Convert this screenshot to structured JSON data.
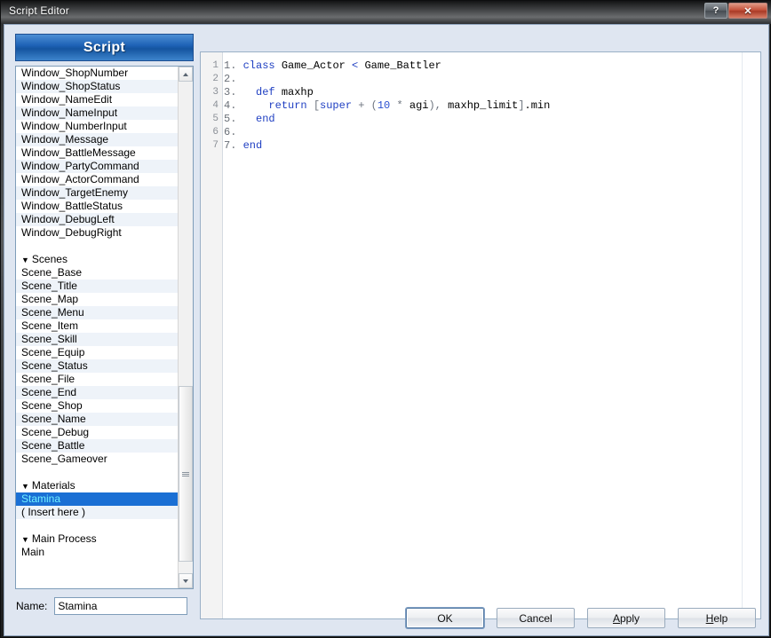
{
  "window": {
    "title": "Script Editor",
    "help_button": "?",
    "close_button": "✕"
  },
  "left_panel": {
    "header": "Script",
    "caret_glyph": "▼",
    "items": [
      {
        "label": "Window_ShopNumber",
        "type": "item"
      },
      {
        "label": "Window_ShopStatus",
        "type": "item"
      },
      {
        "label": "Window_NameEdit",
        "type": "item"
      },
      {
        "label": "Window_NameInput",
        "type": "item"
      },
      {
        "label": "Window_NumberInput",
        "type": "item"
      },
      {
        "label": "Window_Message",
        "type": "item"
      },
      {
        "label": "Window_BattleMessage",
        "type": "item"
      },
      {
        "label": "Window_PartyCommand",
        "type": "item"
      },
      {
        "label": "Window_ActorCommand",
        "type": "item"
      },
      {
        "label": "Window_TargetEnemy",
        "type": "item"
      },
      {
        "label": "Window_BattleStatus",
        "type": "item"
      },
      {
        "label": "Window_DebugLeft",
        "type": "item"
      },
      {
        "label": "Window_DebugRight",
        "type": "item"
      },
      {
        "label": "",
        "type": "blank"
      },
      {
        "label": "Scenes",
        "type": "group"
      },
      {
        "label": "Scene_Base",
        "type": "item"
      },
      {
        "label": "Scene_Title",
        "type": "item"
      },
      {
        "label": "Scene_Map",
        "type": "item"
      },
      {
        "label": "Scene_Menu",
        "type": "item"
      },
      {
        "label": "Scene_Item",
        "type": "item"
      },
      {
        "label": "Scene_Skill",
        "type": "item"
      },
      {
        "label": "Scene_Equip",
        "type": "item"
      },
      {
        "label": "Scene_Status",
        "type": "item"
      },
      {
        "label": "Scene_File",
        "type": "item"
      },
      {
        "label": "Scene_End",
        "type": "item"
      },
      {
        "label": "Scene_Shop",
        "type": "item"
      },
      {
        "label": "Scene_Name",
        "type": "item"
      },
      {
        "label": "Scene_Debug",
        "type": "item"
      },
      {
        "label": "Scene_Battle",
        "type": "item"
      },
      {
        "label": "Scene_Gameover",
        "type": "item"
      },
      {
        "label": "",
        "type": "blank"
      },
      {
        "label": "Materials",
        "type": "group"
      },
      {
        "label": "Stamina",
        "type": "selected"
      },
      {
        "label": "( Insert here )",
        "type": "item"
      },
      {
        "label": "",
        "type": "blank"
      },
      {
        "label": "Main Process",
        "type": "group"
      },
      {
        "label": "Main",
        "type": "item"
      }
    ]
  },
  "name_field": {
    "label": "Name:",
    "value": "Stamina",
    "placeholder": ""
  },
  "editor": {
    "line_numbers": [
      "1",
      "2",
      "3",
      "4",
      "5",
      "6",
      "7"
    ],
    "lines": [
      {
        "num": "1.",
        "segments": [
          {
            "t": "class ",
            "c": "kw"
          },
          {
            "t": "Game_Actor ",
            "c": ""
          },
          {
            "t": "< ",
            "c": "kw"
          },
          {
            "t": "Game_Battler",
            "c": ""
          }
        ]
      },
      {
        "num": "2.",
        "segments": []
      },
      {
        "num": "3.",
        "segments": [
          {
            "t": "  def ",
            "c": "kw"
          },
          {
            "t": "maxhp",
            "c": ""
          }
        ]
      },
      {
        "num": "4.",
        "segments": [
          {
            "t": "    return ",
            "c": "kw"
          },
          {
            "t": "[",
            "c": "op"
          },
          {
            "t": "super",
            "c": "kw"
          },
          {
            "t": " + (",
            "c": "op"
          },
          {
            "t": "10",
            "c": "num"
          },
          {
            "t": " * ",
            "c": "op"
          },
          {
            "t": "agi",
            "c": ""
          },
          {
            "t": "), ",
            "c": "op"
          },
          {
            "t": "maxhp_limit",
            "c": ""
          },
          {
            "t": "]",
            "c": "op"
          },
          {
            "t": ".min",
            "c": ""
          }
        ]
      },
      {
        "num": "5.",
        "segments": [
          {
            "t": "  end",
            "c": "kw"
          }
        ]
      },
      {
        "num": "6.",
        "segments": []
      },
      {
        "num": "7.",
        "segments": [
          {
            "t": "end",
            "c": "kw"
          }
        ]
      }
    ]
  },
  "buttons": [
    {
      "label": "OK",
      "underline": "",
      "focused": true
    },
    {
      "label": "Cancel",
      "underline": "",
      "focused": false
    },
    {
      "label": "Apply",
      "underline": "A",
      "focused": false
    },
    {
      "label": "Help",
      "underline": "H",
      "focused": false
    }
  ],
  "colors": {
    "accent": "#1e62b6",
    "selection": "#1a6fd4",
    "selection_text": "#6ff0ff",
    "dialog_bg": "#dfe6f1",
    "keyword": "#1f3fc2",
    "close_red": "#c4513a"
  }
}
